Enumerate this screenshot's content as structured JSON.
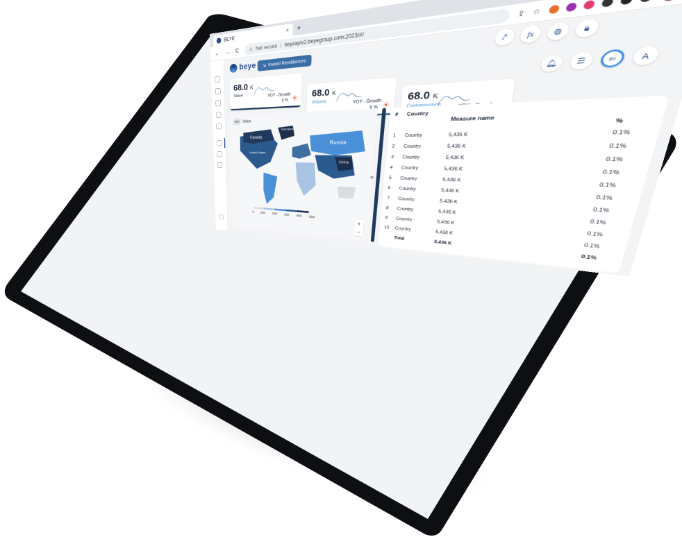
{
  "browser": {
    "tab_title": "BEYE",
    "tab_close": "×",
    "new_tab": "+",
    "url_warning": "Not secure",
    "url_separator": "|",
    "url": "beyeapiv2.beyegroup.com:2023/#/",
    "profile_initial": "A",
    "window_minimize": "—",
    "window_restore": "▢",
    "window_close": "✕",
    "back": "←",
    "forward": "→",
    "reload": "C",
    "menu": "⋮",
    "extension_colors": [
      "#e8702a",
      "#9b2fae",
      "#e03b6d",
      "#333333",
      "#222222",
      "#333333"
    ]
  },
  "app": {
    "logo_text": "beye",
    "active_tab": "Inward Remittances",
    "kpis": [
      {
        "value": "68.0",
        "unit": "K",
        "label": "Value",
        "growth_label": "YOY - Growth",
        "growth_value": "6 %",
        "bar_color": "#1f3a5c"
      },
      {
        "value": "68.0",
        "unit": "K",
        "label": "Volume",
        "growth_label": "YOY - Growth",
        "growth_value": "6 %",
        "bar_color": "#3f6f9e"
      },
      {
        "value": "68.0",
        "unit": "K",
        "label": "Commissions",
        "growth_label": "YOY - Growth",
        "growth_value": "6 %",
        "bar_color": "#3f8fe0"
      }
    ],
    "tool_icons": [
      "share-icon",
      "formula-icon",
      "globe-icon",
      "lock-icon"
    ],
    "tool_icons_row2": [
      "bell-icon",
      "list-check-icon",
      "progress-icon",
      "translate-icon"
    ],
    "progress_ring_label": "80",
    "map": {
      "filter_label": "KPI",
      "filter_value": "Value",
      "country_labels": [
        "Russia",
        "Canada",
        "United States",
        "Greenland",
        "China"
      ],
      "legend_ticks": [
        "0",
        "100",
        "200",
        "300",
        "400",
        "500"
      ],
      "legend_colors": [
        "#d9dde2",
        "#a9c4e2",
        "#4a90d9",
        "#2a5a8e",
        "#1b2f4a"
      ],
      "zoom_in": "+",
      "zoom_out": "−"
    },
    "table": {
      "headers": {
        "rank": "#",
        "country": "Country",
        "measure": "Measure name",
        "percent": "%"
      },
      "rows": [
        {
          "rank": "1",
          "country": "Country",
          "measure": "5,436 K",
          "percent": "0.1%"
        },
        {
          "rank": "2",
          "country": "Country",
          "measure": "5,436 K",
          "percent": "0.1%"
        },
        {
          "rank": "3",
          "country": "Country",
          "measure": "5,436 K",
          "percent": "0.1%"
        },
        {
          "rank": "4",
          "country": "Country",
          "measure": "5,436 K",
          "percent": "0.1%"
        },
        {
          "rank": "5",
          "country": "Country",
          "measure": "5,436 K",
          "percent": "0.1%"
        },
        {
          "rank": "6",
          "country": "Country",
          "measure": "5,436 K",
          "percent": "0.1%"
        },
        {
          "rank": "7",
          "country": "Country",
          "measure": "5,436 K",
          "percent": "0.1%"
        },
        {
          "rank": "8",
          "country": "Country",
          "measure": "5,436 K",
          "percent": "0.1%"
        },
        {
          "rank": "9",
          "country": "Country",
          "measure": "5,436 K",
          "percent": "0.1%"
        },
        {
          "rank": "10",
          "country": "Country",
          "measure": "5,436 K",
          "percent": "0.1%"
        }
      ],
      "total": {
        "label": "Total",
        "measure": "5,436 K",
        "percent": "0.1%"
      }
    }
  }
}
